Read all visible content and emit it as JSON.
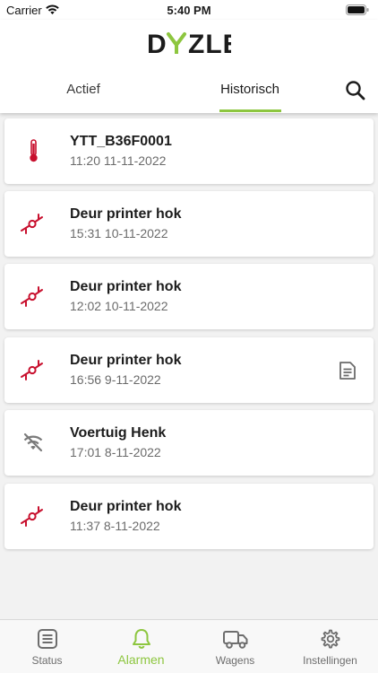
{
  "status_bar": {
    "carrier": "Carrier",
    "time": "5:40 PM"
  },
  "header": {
    "logo_text": "DYZLE",
    "tabs": [
      {
        "label": "Actief",
        "active": false
      },
      {
        "label": "Historisch",
        "active": true
      }
    ],
    "search_icon": "search-icon"
  },
  "alarms": [
    {
      "title": "YTT_B36F0001",
      "time": "11:20 11-11-2022",
      "icon": "thermometer-icon",
      "has_note": false
    },
    {
      "title": "Deur printer hok",
      "time": "15:31 10-11-2022",
      "icon": "door-sensor-icon",
      "has_note": false
    },
    {
      "title": "Deur printer hok",
      "time": "12:02 10-11-2022",
      "icon": "door-sensor-icon",
      "has_note": false
    },
    {
      "title": "Deur printer hok",
      "time": "16:56 9-11-2022",
      "icon": "door-sensor-icon",
      "has_note": true
    },
    {
      "title": "Voertuig Henk",
      "time": "17:01 8-11-2022",
      "icon": "wifi-off-icon",
      "has_note": false
    },
    {
      "title": "Deur printer hok",
      "time": "11:37 8-11-2022",
      "icon": "door-sensor-icon",
      "has_note": false
    }
  ],
  "tab_bar": [
    {
      "label": "Status",
      "icon": "list-icon",
      "active": false
    },
    {
      "label": "Alarmen",
      "icon": "bell-icon",
      "active": true
    },
    {
      "label": "Wagens",
      "icon": "truck-icon",
      "active": false
    },
    {
      "label": "Instellingen",
      "icon": "gear-icon",
      "active": false
    }
  ],
  "colors": {
    "accent": "#8dc63f",
    "alarm_red": "#c8102e",
    "text_primary": "#1c1c1c",
    "text_secondary": "#6b6b6b"
  }
}
